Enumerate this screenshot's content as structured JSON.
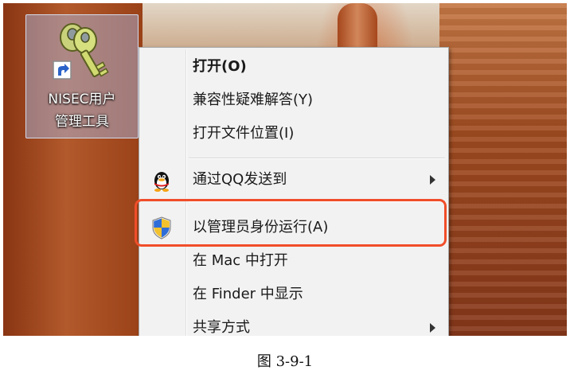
{
  "desktop": {
    "icon": {
      "label": "NISEC用户\n管理工具",
      "icon_name": "key-icon"
    }
  },
  "context_menu": {
    "items": [
      {
        "label": "打开(O)",
        "bold": true
      },
      {
        "label": "兼容性疑难解答(Y)"
      },
      {
        "label": "打开文件位置(I)"
      },
      {
        "label": "通过QQ发送到",
        "icon": "qq-penguin-icon",
        "submenu": true
      },
      {
        "label": "以管理员身份运行(A)",
        "icon": "uac-shield-icon",
        "highlighted": true
      },
      {
        "label": "在 Mac 中打开"
      },
      {
        "label": "在 Finder 中显示"
      },
      {
        "label": "共享方式",
        "submenu": true
      }
    ],
    "highlight_color": "#f04e2a"
  },
  "caption": "图 3-9-1"
}
